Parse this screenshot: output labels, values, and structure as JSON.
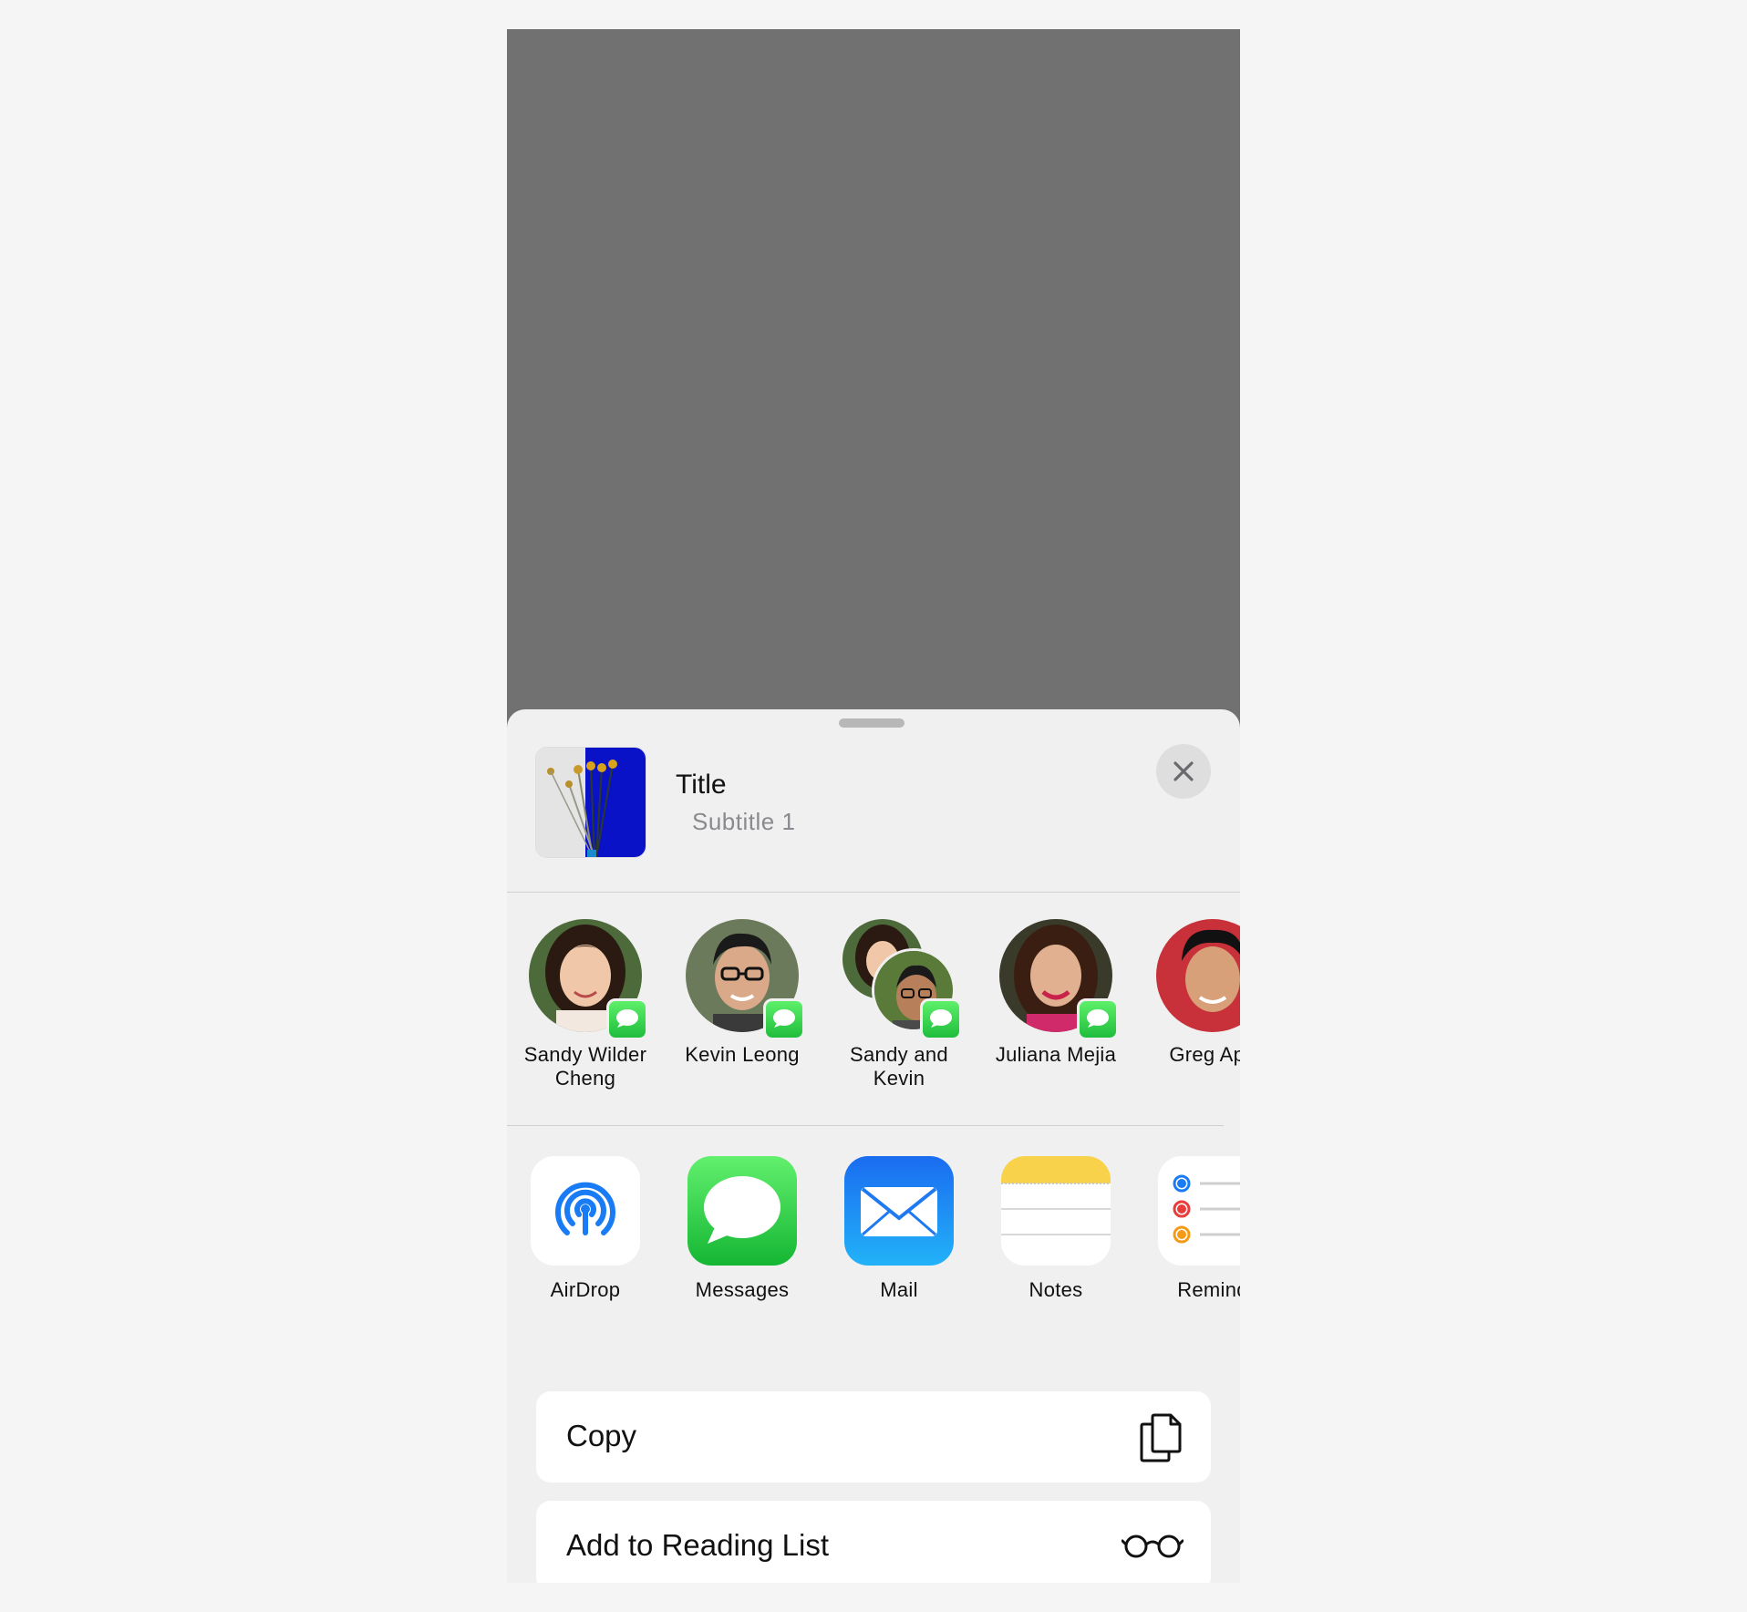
{
  "header": {
    "title": "Title",
    "subtitle": "Subtitle 1"
  },
  "people": [
    {
      "name": "Sandy Wilder Cheng",
      "line1": "Sandy Wilder",
      "line2": "Cheng"
    },
    {
      "name": "Kevin Leong",
      "line1": "Kevin Leong",
      "line2": ""
    },
    {
      "name": "Sandy and Kevin",
      "line1": "Sandy and",
      "line2": "Kevin"
    },
    {
      "name": "Juliana Mejia",
      "line1": "Juliana Mejia",
      "line2": ""
    },
    {
      "name": "Greg Apo",
      "line1": "Greg Apo",
      "line2": ""
    }
  ],
  "apps": [
    {
      "label": "AirDrop",
      "icon": "airdrop-icon"
    },
    {
      "label": "Messages",
      "icon": "messages-icon"
    },
    {
      "label": "Mail",
      "icon": "mail-icon"
    },
    {
      "label": "Notes",
      "icon": "notes-icon"
    },
    {
      "label": "Remind",
      "icon": "reminders-icon"
    }
  ],
  "actions": [
    {
      "label": "Copy",
      "icon": "copy-icon"
    },
    {
      "label": "Add to Reading List",
      "icon": "glasses-icon"
    }
  ],
  "colors": {
    "messages_green": "#28c840",
    "airdrop_blue": "#1a7cf5",
    "mail_blue": "#1d86f5",
    "notes_yellow": "#f7d24a"
  }
}
